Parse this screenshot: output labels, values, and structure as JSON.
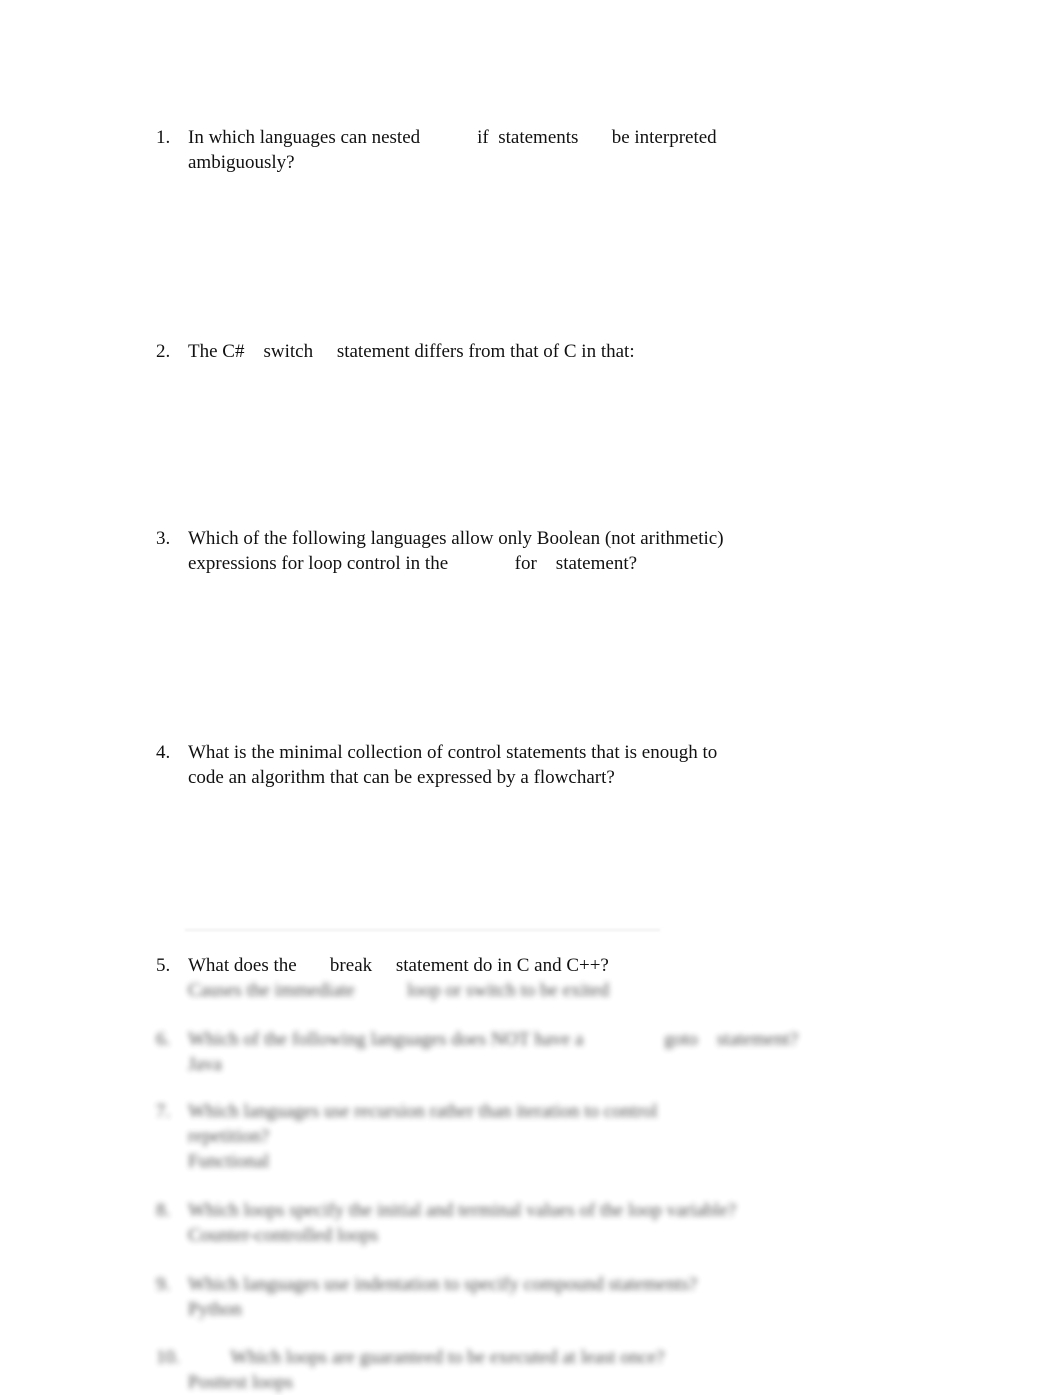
{
  "questions": [
    {
      "num": "1.",
      "lines": [
        "In which languages can nested            if  statements       be interpreted",
        "ambiguously?"
      ]
    },
    {
      "num": "2.",
      "lines": [
        "The C#    switch     statement differs from that of C in that:"
      ]
    },
    {
      "num": "3.",
      "lines": [
        "Which of the following languages allow only Boolean (not arithmetic)",
        "expressions for loop control in the              for    statement?"
      ]
    },
    {
      "num": "4.",
      "lines": [
        "What is the minimal collection of control statements that is enough to",
        "code an algorithm that can be expressed by a flowchart?"
      ]
    },
    {
      "num": "5.",
      "lines": [
        "What does the       break     statement do in C and C++?"
      ]
    }
  ],
  "blurred": [
    {
      "num": "",
      "lines": [
        "Causes the immediate           loop or switch to be exited"
      ]
    },
    {
      "num": "6.",
      "lines": [
        "Which of the following languages does NOT have a                 goto    statement?",
        "Java"
      ]
    },
    {
      "num": "7.",
      "lines": [
        "Which languages use recursion rather than iteration to control",
        "repetition?",
        "Functional"
      ]
    },
    {
      "num": "8.",
      "lines": [
        "Which loops specify the initial and terminal values of the loop variable?",
        "Counter-controlled loops"
      ]
    },
    {
      "num": "9.",
      "lines": [
        "Which languages use indentation to specify compound statements?",
        "Python"
      ]
    },
    {
      "num": "10.",
      "lines": [
        "         Which loops are guaranteed to be executed at least once?",
        "Posttest loops"
      ]
    }
  ]
}
